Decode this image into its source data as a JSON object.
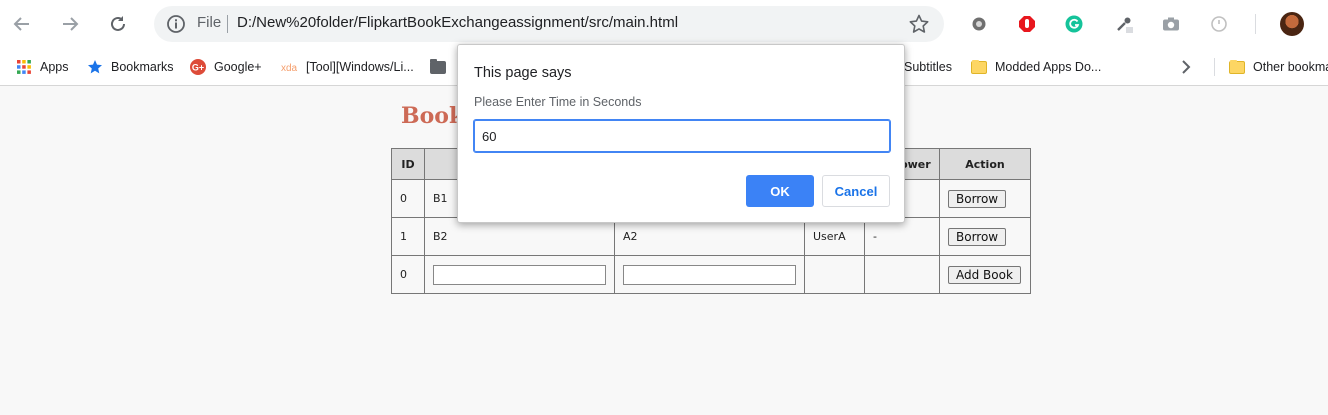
{
  "browser": {
    "file_label": "File",
    "url": "D:/New%20folder/FlipkartBookExchangeassignment/src/main.html"
  },
  "bookmarks": [
    {
      "label": "Apps",
      "icon": "apps-grid-icon"
    },
    {
      "label": "Bookmarks",
      "icon": "star-icon"
    },
    {
      "label": "Google+",
      "icon": "google-plus-icon"
    },
    {
      "label": "[Tool][Windows/Li...",
      "icon": "xda-icon"
    },
    {
      "label": "Subtitles",
      "icon": "folder-icon"
    },
    {
      "label": "Modded Apps Do...",
      "icon": "folder-icon"
    },
    {
      "label": "Other bookmarks",
      "icon": "folder-icon"
    }
  ],
  "page": {
    "title": "Book",
    "table": {
      "headers": [
        "ID",
        "",
        "",
        "",
        "Borrower",
        "Action"
      ],
      "rows": [
        {
          "id": "0",
          "name": "B1",
          "author": "",
          "owner": "",
          "borrower": "",
          "action": "Borrow"
        },
        {
          "id": "1",
          "name": "B2",
          "author": "A2",
          "owner": "UserA",
          "borrower": "-",
          "action": "Borrow"
        }
      ],
      "new_row": {
        "id": "0",
        "action": "Add Book"
      }
    }
  },
  "dialog": {
    "title": "This page says",
    "message": "Please Enter Time in Seconds",
    "input_value": "60",
    "ok_label": "OK",
    "cancel_label": "Cancel"
  },
  "colors": {
    "accent": "#3b82f6",
    "title": "#cd6a56"
  }
}
